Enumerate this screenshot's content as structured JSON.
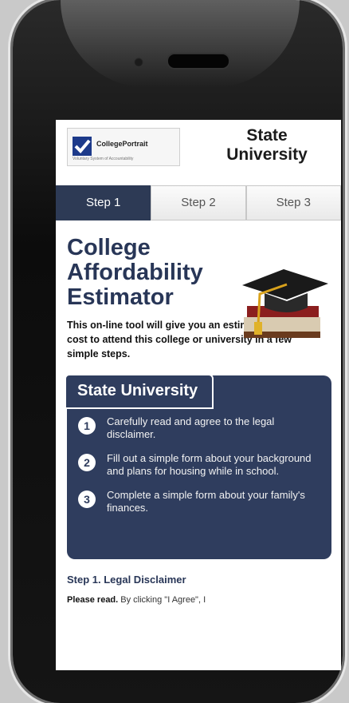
{
  "header": {
    "logo_text": "CollegePortrait",
    "logo_tagline": "Voluntary System of Accountability",
    "university_title_line1": "State",
    "university_title_line2": "University"
  },
  "tabs": [
    {
      "label": "Step 1",
      "active": true
    },
    {
      "label": "Step 2",
      "active": false
    },
    {
      "label": "Step 3",
      "active": false
    }
  ],
  "hero": {
    "title_line1": "College",
    "title_line2": "Affordability",
    "title_line3": "Estimator",
    "intro": "This on-line tool will give you an estimate of your cost to attend this college or university in a few simple steps."
  },
  "card": {
    "title": "State University",
    "steps": [
      {
        "num": "1",
        "text": "Carefully read and agree to the legal disclaimer."
      },
      {
        "num": "2",
        "text": "Fill out a simple form about your background and plans for housing while in school."
      },
      {
        "num": "3",
        "text": "Complete a simple form about your family's finances."
      }
    ]
  },
  "disclaimer": {
    "title": "Step 1. Legal Disclaimer",
    "lead": "Please read.",
    "body": "By clicking \"I Agree\", I"
  },
  "colors": {
    "navy": "#2f3d5e",
    "tab_active": "#2d3a55",
    "title_color": "#283657"
  }
}
